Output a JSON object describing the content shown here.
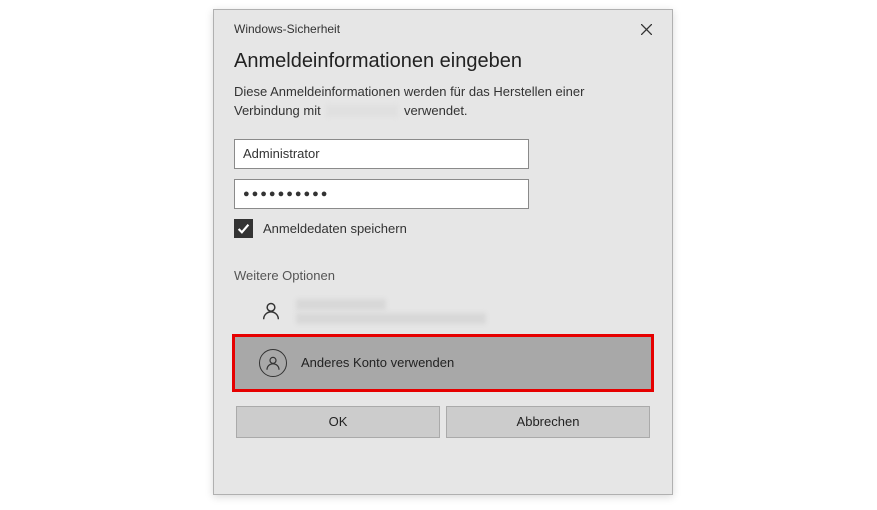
{
  "titlebar": {
    "title": "Windows-Sicherheit"
  },
  "heading": "Anmeldeinformationen eingeben",
  "subtext_before": "Diese Anmeldeinformationen werden für das Herstellen einer Verbindung mit ",
  "subtext_after": " verwendet.",
  "username": "Administrator",
  "password": "●●●●●●●●●●",
  "remember_label": "Anmeldedaten speichern",
  "remember_checked": true,
  "more_options_label": "Weitere Optionen",
  "other_account_label": "Anderes Konto verwenden",
  "buttons": {
    "ok": "OK",
    "cancel": "Abbrechen"
  }
}
